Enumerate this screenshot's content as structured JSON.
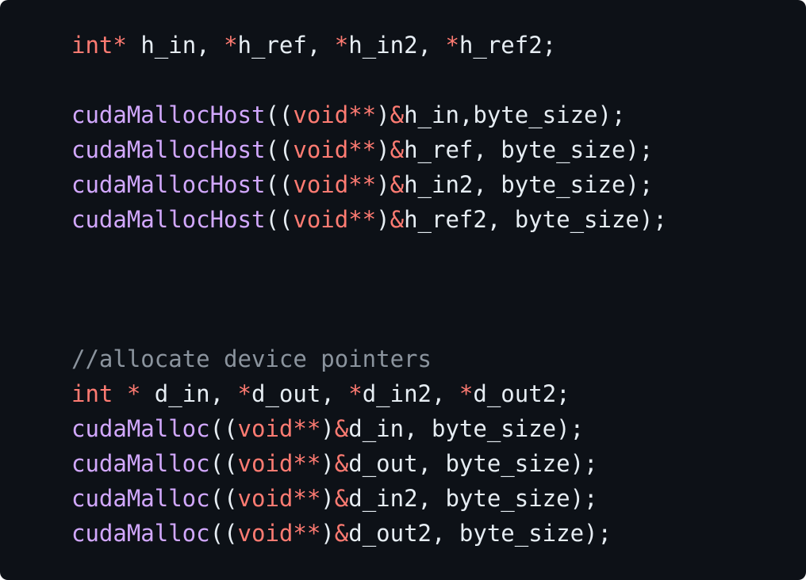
{
  "code": {
    "lines": [
      [
        {
          "t": "int",
          "c": "kw"
        },
        {
          "t": "*",
          "c": "kw"
        },
        {
          "t": " h_in, ",
          "c": "pl"
        },
        {
          "t": "*",
          "c": "kw"
        },
        {
          "t": "h_ref, ",
          "c": "pl"
        },
        {
          "t": "*",
          "c": "kw"
        },
        {
          "t": "h_in2, ",
          "c": "pl"
        },
        {
          "t": "*",
          "c": "kw"
        },
        {
          "t": "h_ref2;",
          "c": "pl"
        }
      ],
      [],
      [
        {
          "t": "cudaMallocHost",
          "c": "fn"
        },
        {
          "t": "((",
          "c": "pl"
        },
        {
          "t": "void**",
          "c": "kw"
        },
        {
          "t": ")",
          "c": "pl"
        },
        {
          "t": "&",
          "c": "kw"
        },
        {
          "t": "h_in,byte_size);",
          "c": "pl"
        }
      ],
      [
        {
          "t": "cudaMallocHost",
          "c": "fn"
        },
        {
          "t": "((",
          "c": "pl"
        },
        {
          "t": "void**",
          "c": "kw"
        },
        {
          "t": ")",
          "c": "pl"
        },
        {
          "t": "&",
          "c": "kw"
        },
        {
          "t": "h_ref, byte_size);",
          "c": "pl"
        }
      ],
      [
        {
          "t": "cudaMallocHost",
          "c": "fn"
        },
        {
          "t": "((",
          "c": "pl"
        },
        {
          "t": "void**",
          "c": "kw"
        },
        {
          "t": ")",
          "c": "pl"
        },
        {
          "t": "&",
          "c": "kw"
        },
        {
          "t": "h_in2, byte_size);",
          "c": "pl"
        }
      ],
      [
        {
          "t": "cudaMallocHost",
          "c": "fn"
        },
        {
          "t": "((",
          "c": "pl"
        },
        {
          "t": "void**",
          "c": "kw"
        },
        {
          "t": ")",
          "c": "pl"
        },
        {
          "t": "&",
          "c": "kw"
        },
        {
          "t": "h_ref2, byte_size);",
          "c": "pl"
        }
      ],
      [],
      [],
      [],
      [
        {
          "t": "//allocate device pointers",
          "c": "cm"
        }
      ],
      [
        {
          "t": "int",
          "c": "kw"
        },
        {
          "t": " ",
          "c": "pl"
        },
        {
          "t": "*",
          "c": "kw"
        },
        {
          "t": " d_in, ",
          "c": "pl"
        },
        {
          "t": "*",
          "c": "kw"
        },
        {
          "t": "d_out, ",
          "c": "pl"
        },
        {
          "t": "*",
          "c": "kw"
        },
        {
          "t": "d_in2, ",
          "c": "pl"
        },
        {
          "t": "*",
          "c": "kw"
        },
        {
          "t": "d_out2;",
          "c": "pl"
        }
      ],
      [
        {
          "t": "cudaMalloc",
          "c": "fn"
        },
        {
          "t": "((",
          "c": "pl"
        },
        {
          "t": "void**",
          "c": "kw"
        },
        {
          "t": ")",
          "c": "pl"
        },
        {
          "t": "&",
          "c": "kw"
        },
        {
          "t": "d_in, byte_size);",
          "c": "pl"
        }
      ],
      [
        {
          "t": "cudaMalloc",
          "c": "fn"
        },
        {
          "t": "((",
          "c": "pl"
        },
        {
          "t": "void**",
          "c": "kw"
        },
        {
          "t": ")",
          "c": "pl"
        },
        {
          "t": "&",
          "c": "kw"
        },
        {
          "t": "d_out, byte_size);",
          "c": "pl"
        }
      ],
      [
        {
          "t": "cudaMalloc",
          "c": "fn"
        },
        {
          "t": "((",
          "c": "pl"
        },
        {
          "t": "void**",
          "c": "kw"
        },
        {
          "t": ")",
          "c": "pl"
        },
        {
          "t": "&",
          "c": "kw"
        },
        {
          "t": "d_in2, byte_size);",
          "c": "pl"
        }
      ],
      [
        {
          "t": "cudaMalloc",
          "c": "fn"
        },
        {
          "t": "((",
          "c": "pl"
        },
        {
          "t": "void**",
          "c": "kw"
        },
        {
          "t": ")",
          "c": "pl"
        },
        {
          "t": "&",
          "c": "kw"
        },
        {
          "t": "d_out2, byte_size);",
          "c": "pl"
        }
      ]
    ]
  },
  "colors": {
    "background": "#0d1117",
    "keyword": "#ff7b72",
    "function": "#d2a8ff",
    "comment": "#8b949e",
    "plain": "#e6edf3"
  }
}
